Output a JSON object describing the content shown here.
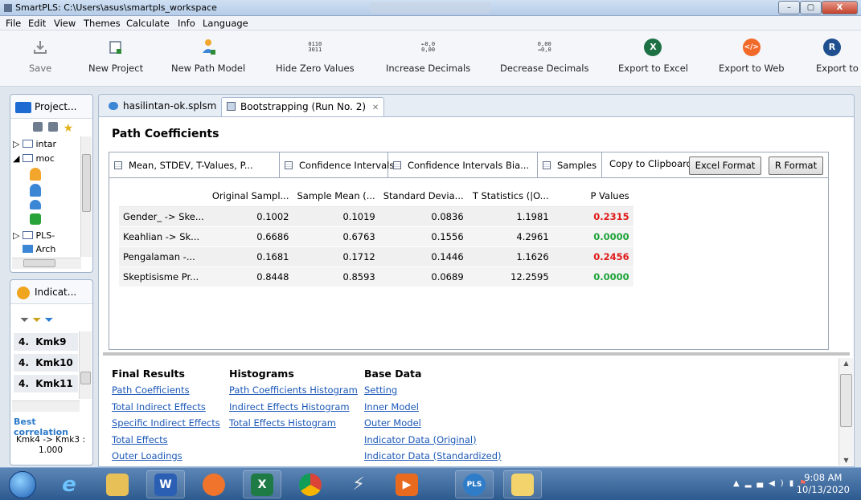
{
  "window": {
    "title": "SmartPLS: C:\\Users\\asus\\smartpls_workspace",
    "controls": [
      "–",
      "▢",
      "X"
    ]
  },
  "menu": [
    "File",
    "Edit",
    "View",
    "Themes",
    "Calculate",
    "Info",
    "Language"
  ],
  "toolbar": {
    "save": "Save",
    "new_project": "New Project",
    "new_path_model": "New Path Model",
    "hide_zero_values": "Hide Zero Values",
    "increase_decimals": "Increase Decimals",
    "decrease_decimals": "Decrease Decimals",
    "export_excel": "Export to Excel",
    "export_web": "Export to Web",
    "export_r": "Export to R",
    "icon_text": {
      "hide_zero_top": "0110",
      "hide_zero_bottom": "3011",
      "inc_top": "0,0",
      "inc_bottom": "0,00",
      "dec_top": "0,00",
      "dec_bottom": "0,0",
      "excel": "X",
      "web": "</>",
      "r": "R"
    },
    "colors": {
      "excel": "#1d7044",
      "web": "#f26a2a",
      "r": "#1f4f8f"
    }
  },
  "project_panel": {
    "title": "Project...",
    "tree": [
      "intar",
      "moc",
      "PLS-",
      "Arch"
    ]
  },
  "indicator_panel": {
    "title": "Indicat...",
    "items": [
      {
        "num": "4.",
        "label": "Kmk9"
      },
      {
        "num": "4.",
        "label": "Kmk10"
      },
      {
        "num": "4.",
        "label": "Kmk11"
      }
    ],
    "best_correlation_label": "Best correlation",
    "best_correlation_pair": "Kmk4 -> Kmk3 :",
    "best_correlation_value": "1.000"
  },
  "tabs": [
    {
      "label": "hasilintan-ok.splsm"
    },
    {
      "label": "Bootstrapping (Run No. 2)",
      "close": "✕"
    }
  ],
  "report": {
    "title": "Path Coefficients",
    "subtabs": [
      "Mean, STDEV, T-Values, P...",
      "Confidence Intervals",
      "Confidence Intervals Bia...",
      "Samples"
    ],
    "copy_label": "Copy to Clipboard:",
    "excel_format": "Excel Format",
    "r_format": "R Format",
    "columns": [
      "",
      "Original Sampl...",
      "Sample Mean (...",
      "Standard Devia...",
      "T Statistics (|O...",
      "P Values"
    ],
    "rows": [
      {
        "label": "Gender_ -> Ske...",
        "original": "0.1002",
        "mean": "0.1019",
        "stdev": "0.0836",
        "t": "1.1981",
        "p": "0.2315",
        "sig": false
      },
      {
        "label": "Keahlian -> Sk...",
        "original": "0.6686",
        "mean": "0.6763",
        "stdev": "0.1556",
        "t": "4.2961",
        "p": "0.0000",
        "sig": true
      },
      {
        "label": "Pengalaman -...",
        "original": "0.1681",
        "mean": "0.1712",
        "stdev": "0.1446",
        "t": "1.1626",
        "p": "0.2456",
        "sig": false
      },
      {
        "label": "Skeptisisme Pr...",
        "original": "0.8448",
        "mean": "0.8593",
        "stdev": "0.0689",
        "t": "12.2595",
        "p": "0.0000",
        "sig": true
      }
    ]
  },
  "nav": {
    "final_results": {
      "heading": "Final Results",
      "links": [
        "Path Coefficients",
        "Total Indirect Effects",
        "Specific Indirect Effects",
        "Total Effects",
        "Outer Loadings"
      ]
    },
    "histograms": {
      "heading": "Histograms",
      "links": [
        "Path Coefficients Histogram",
        "Indirect Effects Histogram",
        "Total Effects Histogram"
      ]
    },
    "base_data": {
      "heading": "Base Data",
      "links": [
        "Setting",
        "Inner Model",
        "Outer Model",
        "Indicator Data (Original)",
        "Indicator Data (Standardized)"
      ]
    }
  },
  "taskbar": {
    "time": "9:08 AM",
    "date": "10/13/2020",
    "apps": [
      "Start",
      "Internet Explorer",
      "File Explorer",
      "Word",
      "Firefox",
      "Excel",
      "Chrome",
      "Tool",
      "Media",
      "SmartPLS",
      "Paint"
    ]
  }
}
